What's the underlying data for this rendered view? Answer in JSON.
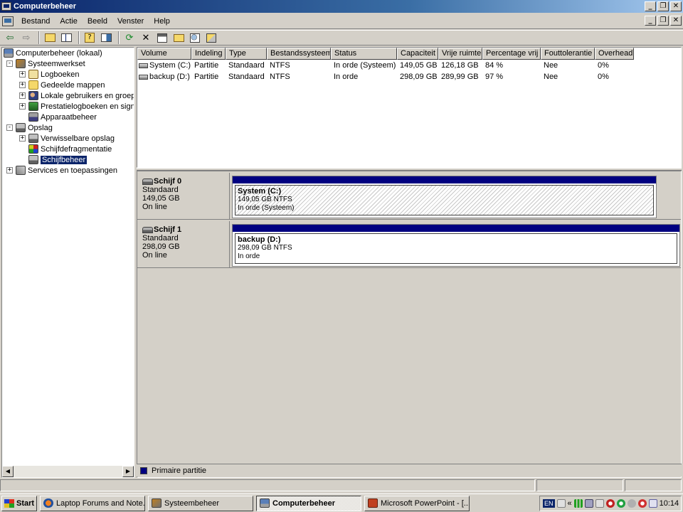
{
  "window": {
    "title": "Computerbeheer",
    "buttons": [
      "_",
      "❐",
      "✕"
    ],
    "mdi_buttons": [
      "_",
      "❐",
      "✕"
    ]
  },
  "menu": [
    "Bestand",
    "Actie",
    "Beeld",
    "Venster",
    "Help"
  ],
  "toolbar": {
    "icons": [
      "back-arrow-icon",
      "forward-arrow-icon",
      "up-folder-icon",
      "show-hide-tree-icon",
      "properties-icon",
      "help-icon",
      "refresh-icon",
      "delete-icon",
      "properties2-icon",
      "open-icon",
      "search-icon",
      "settings-icon"
    ]
  },
  "tree": {
    "root": "Computerbeheer (lokaal)",
    "systeemwerkset": "Systeemwerkset",
    "logboeken": "Logboeken",
    "gedeelde_mappen": "Gedeelde mappen",
    "lokale_gebruikers": "Lokale gebruikers en groepe",
    "prestatie": "Prestatielogboeken en signa",
    "apparaat": "Apparaatbeheer",
    "opslag": "Opslag",
    "verwisselbare": "Verwisselbare opslag",
    "defrag": "Schijfdefragmentatie",
    "schijfbeheer": "Schijfbeheer",
    "services": "Services en toepassingen",
    "expand_plus": "+",
    "expand_minus": "-"
  },
  "volumes": {
    "columns": [
      "Volume",
      "Indeling",
      "Type",
      "Bestandssysteem",
      "Status",
      "Capaciteit",
      "Vrije ruimte",
      "Percentage vrij",
      "Fouttolerantie",
      "Overhead"
    ],
    "rows": [
      [
        "System (C:)",
        "Partitie",
        "Standaard",
        "NTFS",
        "In orde (Systeem)",
        "149,05 GB",
        "126,18 GB",
        "84 %",
        "Nee",
        "0%"
      ],
      [
        "backup (D:)",
        "Partitie",
        "Standaard",
        "NTFS",
        "In orde",
        "298,09 GB",
        "289,99 GB",
        "97 %",
        "Nee",
        "0%"
      ]
    ]
  },
  "disks": [
    {
      "name": "Schijf 0",
      "type": "Standaard",
      "size": "149,05 GB",
      "state": "On line",
      "partition": {
        "name": "System  (C:)",
        "detail": "149,05 GB NTFS",
        "status": "In orde (Systeem)"
      }
    },
    {
      "name": "Schijf 1",
      "type": "Standaard",
      "size": "298,09 GB",
      "state": "On line",
      "partition": {
        "name": "backup  (D:)",
        "detail": "298,09 GB NTFS",
        "status": "In orde"
      }
    }
  ],
  "legend": {
    "label": "Primaire partitie",
    "color": "#000080"
  },
  "taskbar": {
    "start": "Start",
    "tasks": [
      "Laptop Forums and Note...",
      "Systeembeheer",
      "Computerbeheer",
      "Microsoft PowerPoint - [..."
    ],
    "language": "EN",
    "clock": "10:14",
    "tray_chevron": "«"
  }
}
